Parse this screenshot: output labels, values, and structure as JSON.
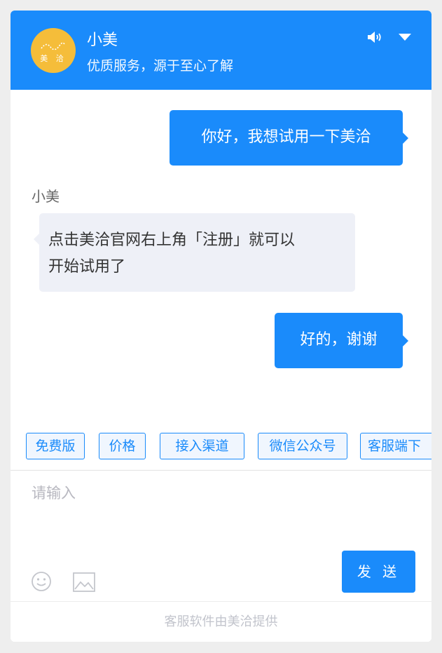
{
  "header": {
    "avatar_text": "美 洽",
    "agent_name": "小美",
    "slogan": "优质服务，源于至心了解",
    "icons": [
      "volume-icon",
      "chevron-down-icon"
    ]
  },
  "messages": [
    {
      "from": "visitor",
      "text": "你好，我想试用一下美洽"
    },
    {
      "from": "agent",
      "sender": "小美",
      "lines": [
        "点击美洽官网右上角「注册」就可以",
        "开始试用了"
      ]
    },
    {
      "from": "visitor",
      "text": "好的，谢谢"
    }
  ],
  "quick_replies": [
    "免费版",
    "价格",
    "接入渠道",
    "微信公众号",
    "客服端下"
  ],
  "input": {
    "placeholder": "请输入"
  },
  "toolbar": {
    "icons": [
      "emoji-icon",
      "image-icon"
    ]
  },
  "send_label": "发 送",
  "footer_text": "客服软件由美洽提供",
  "colors": {
    "primary": "#1a8bfb",
    "avatar": "#f5bd3a",
    "agent_bubble": "#eef0f7"
  }
}
